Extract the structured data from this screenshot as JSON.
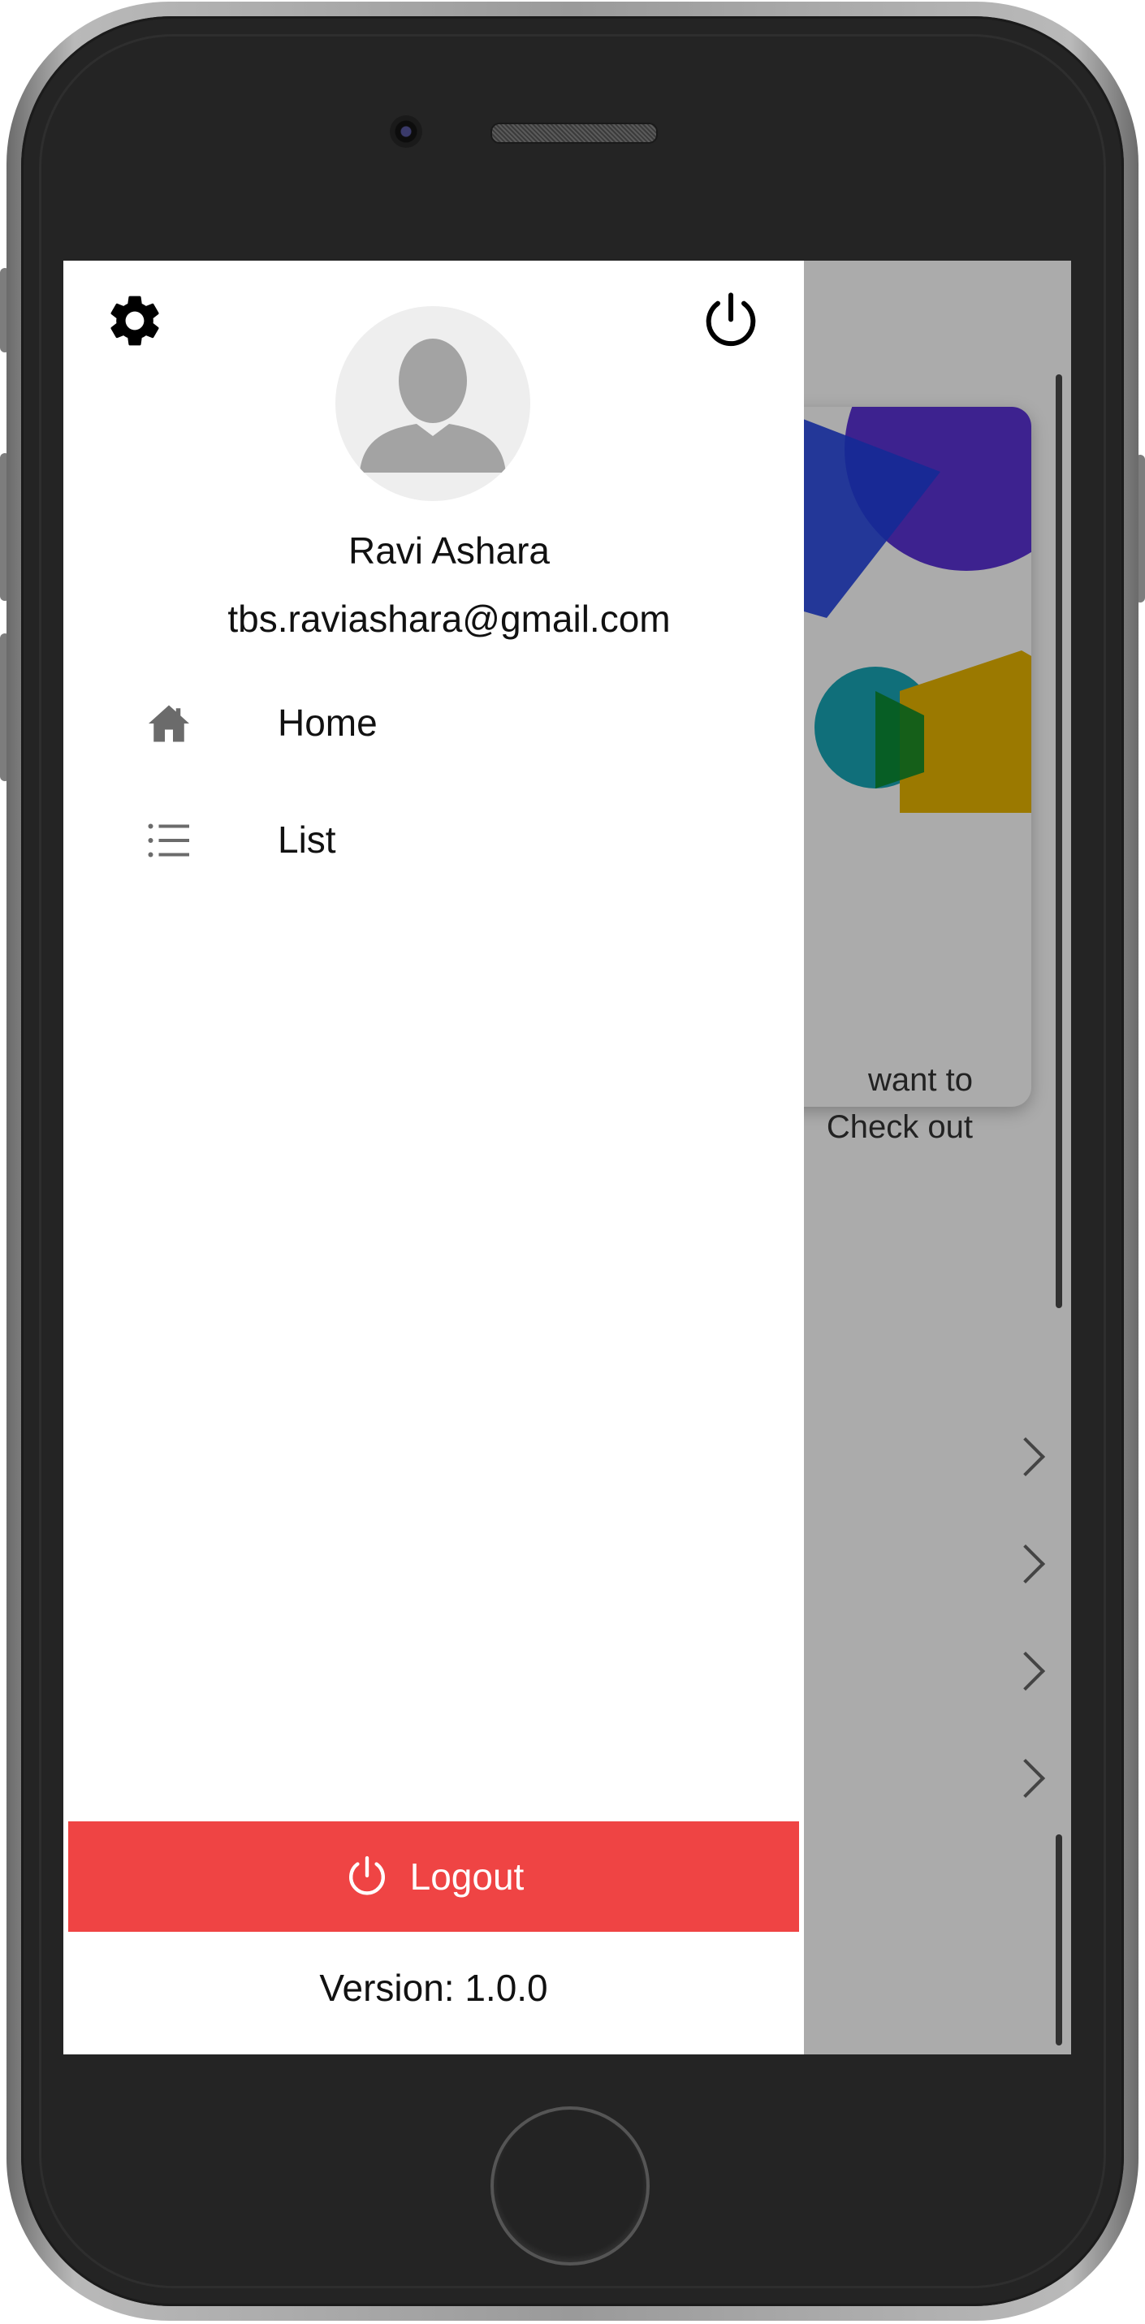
{
  "drawer": {
    "user": {
      "name": "Ravi Ashara",
      "email": "tbs.raviashara@gmail.com"
    },
    "menu": [
      {
        "label": "Home",
        "icon": "home-icon"
      },
      {
        "label": "List",
        "icon": "list-icon"
      }
    ],
    "logout_label": "Logout",
    "version": "Version: 1.0.0",
    "header_icons": [
      "gear-icon",
      "power-icon"
    ]
  },
  "background": {
    "card_text_lines": [
      "want to",
      "Check out",
      "."
    ]
  },
  "colors": {
    "logout": "#ef4444",
    "overlay": "rgba(0,0,0,0.33)",
    "icon_gray": "#6b6b6b"
  }
}
